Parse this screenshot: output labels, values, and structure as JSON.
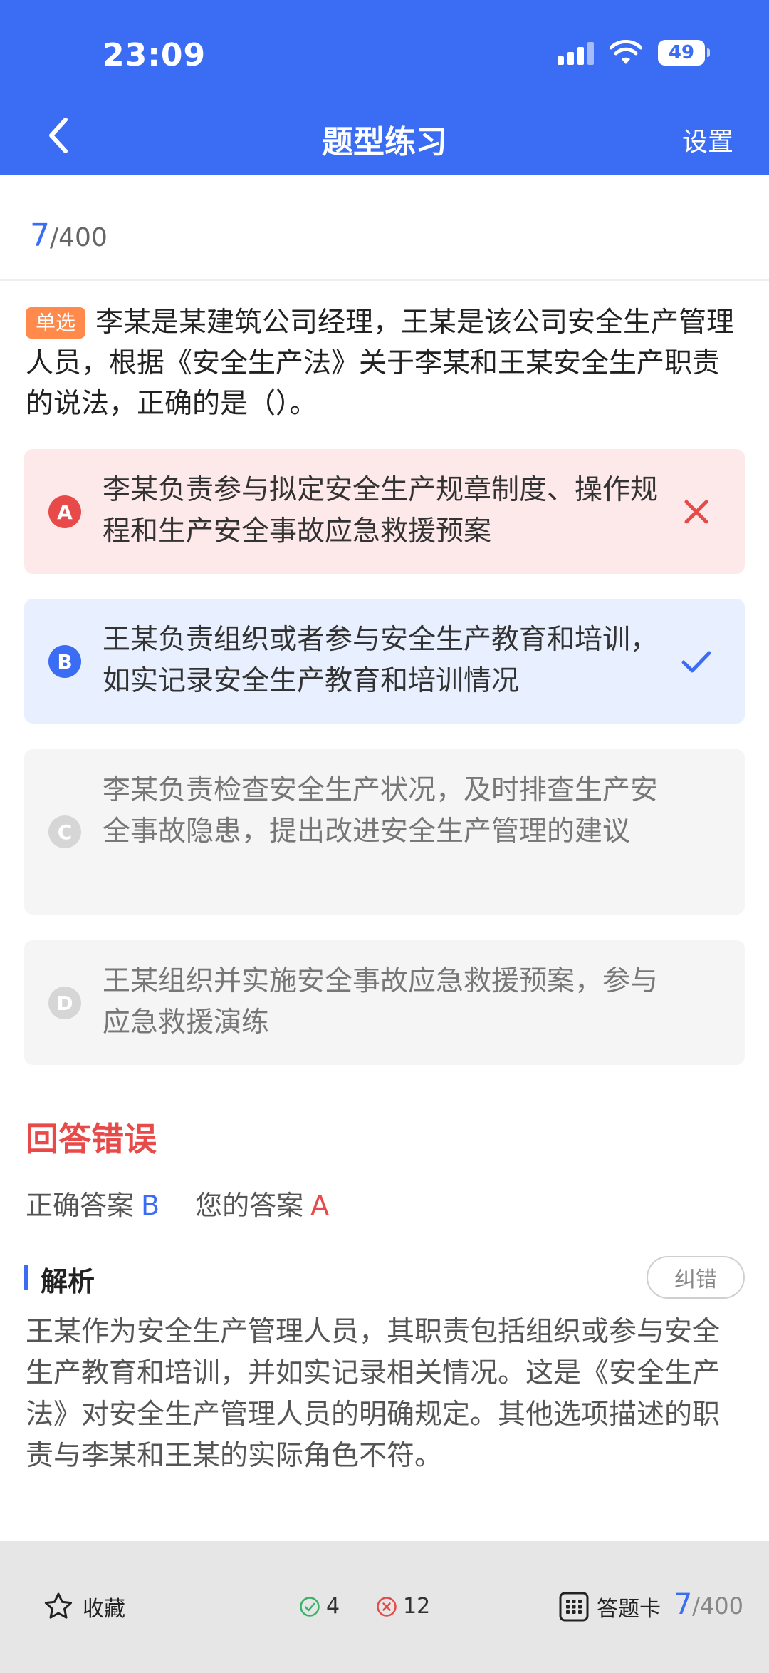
{
  "status_bar": {
    "time": "23:09",
    "battery": "49"
  },
  "nav": {
    "title": "题型练习",
    "settings_label": "设置"
  },
  "progress": {
    "current": "7",
    "total": "/400"
  },
  "question": {
    "type_label": "单选",
    "text": "李某是某建筑公司经理，王某是该公司安全生产管理人员，根据《安全生产法》关于李某和王某安全生产职责的说法，正确的是（）。"
  },
  "options": [
    {
      "letter": "A",
      "text": "李某负责参与拟定安全生产规章制度、操作规程和生产安全事故应急救援预案",
      "state": "wrong"
    },
    {
      "letter": "B",
      "text": "王某负责组织或者参与安全生产教育和培训，如实记录安全生产教育和培训情况",
      "state": "correct"
    },
    {
      "letter": "C",
      "text": "李某负责检查安全生产状况，及时排查生产安全事故隐患，提出改进安全生产管理的建议",
      "state": "neutral"
    },
    {
      "letter": "D",
      "text": "王某组织并实施安全事故应急救援预案，参与应急救援演练",
      "state": "neutral"
    }
  ],
  "result": {
    "title": "回答错误",
    "correct_label": "正确答案",
    "correct_value": "B",
    "yours_label": "您的答案",
    "yours_value": "A"
  },
  "analysis": {
    "title": "解析",
    "report_label": "纠错",
    "text": "王某作为安全生产管理人员，其职责包括组织或参与安全生产教育和培训，并如实记录相关情况。这是《安全生产法》对安全生产管理人员的明确规定。其他选项描述的职责与李某和王某的实际角色不符。"
  },
  "bottom": {
    "favorite_label": "收藏",
    "correct_count": "4",
    "wrong_count": "12",
    "card_label": "答题卡",
    "card_current": "7",
    "card_total": "/400"
  },
  "colors": {
    "primary": "#3a6cf4",
    "error": "#e84a4a",
    "tag": "#ff8a4c"
  },
  "icons": [
    "back-arrow-icon",
    "signal-icon",
    "wifi-icon",
    "battery-icon",
    "wrong-x-icon",
    "correct-check-icon",
    "star-icon",
    "check-circle-icon",
    "x-circle-icon",
    "grid-icon"
  ]
}
